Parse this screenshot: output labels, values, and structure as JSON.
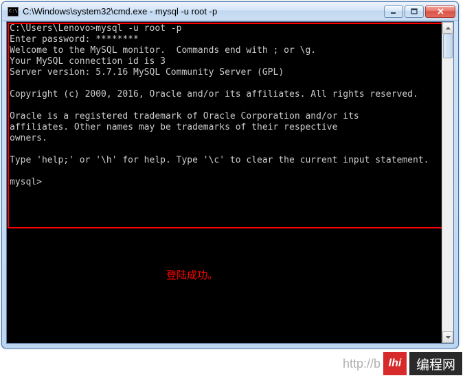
{
  "window": {
    "title": "C:\\Windows\\system32\\cmd.exe - mysql  -u root -p"
  },
  "terminal": {
    "line1_prompt": "C:\\Users\\Lenovo>",
    "line1_cmd": "mysql -u root -p",
    "line2": "Enter password: ********",
    "line3": "Welcome to the MySQL monitor.  Commands end with ; or \\g.",
    "line4": "Your MySQL connection id is 3",
    "line5": "Server version: 5.7.16 MySQL Community Server (GPL)",
    "line6": "Copyright (c) 2000, 2016, Oracle and/or its affiliates. All rights reserved.",
    "line7": "Oracle is a registered trademark of Oracle Corporation and/or its",
    "line8": "affiliates. Other names may be trademarks of their respective",
    "line9": "owners.",
    "line10": "Type 'help;' or '\\h' for help. Type '\\c' to clear the current input statement.",
    "line11_prompt": "mysql>"
  },
  "annotation": {
    "text": "登陆成功。"
  },
  "watermark": {
    "url_fragment": "http://b",
    "badge_text": "lhi",
    "site_text": "编程网"
  }
}
